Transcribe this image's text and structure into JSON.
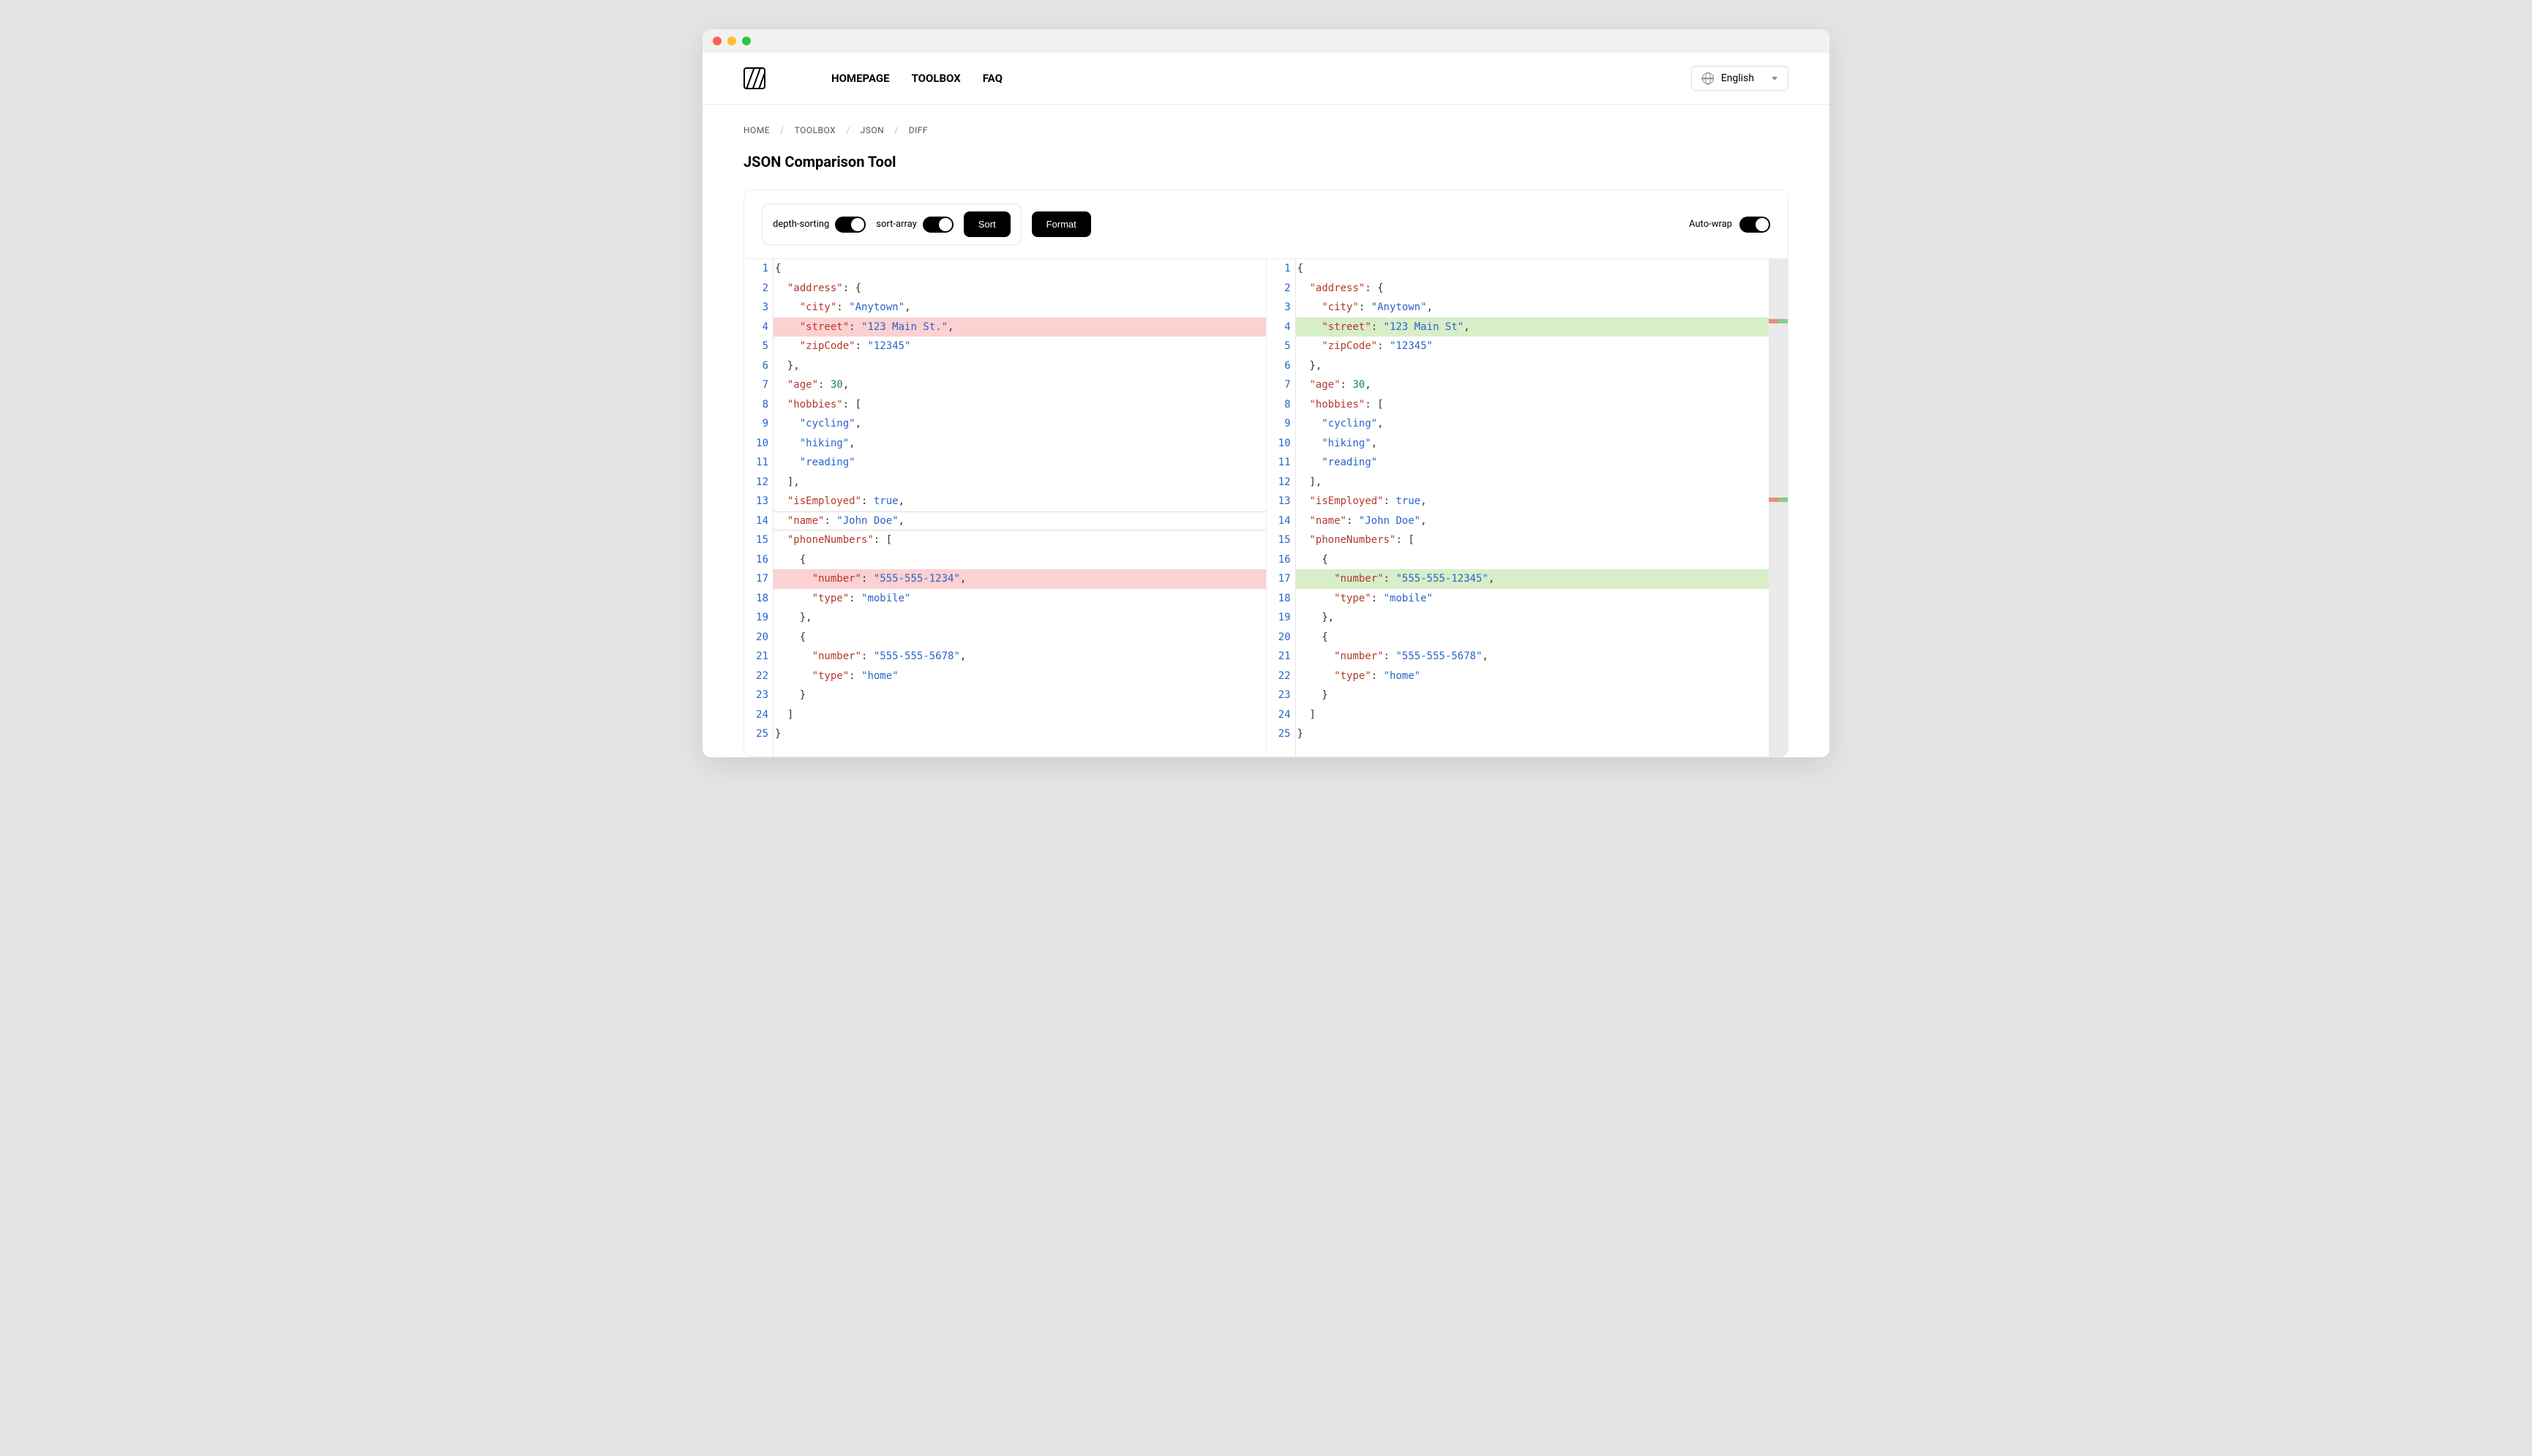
{
  "nav": {
    "items": [
      "HOMEPAGE",
      "TOOLBOX",
      "FAQ"
    ]
  },
  "lang": {
    "label": "English"
  },
  "breadcrumb": [
    "HOME",
    "TOOLBOX",
    "JSON",
    "DIFF"
  ],
  "page_title": "JSON Comparison Tool",
  "toolbar": {
    "depth_sorting": "depth-sorting",
    "sort_array": "sort-array",
    "sort_btn": "Sort",
    "format_btn": "Format",
    "auto_wrap": "Auto-wrap"
  },
  "left": {
    "lines": [
      {
        "n": 1,
        "hl": "",
        "tokens": [
          {
            "t": "punc",
            "v": "{"
          }
        ]
      },
      {
        "n": 2,
        "hl": "",
        "tokens": [
          {
            "t": "ind",
            "v": "  "
          },
          {
            "t": "key",
            "v": "\"address\""
          },
          {
            "t": "punc",
            "v": ": {"
          }
        ]
      },
      {
        "n": 3,
        "hl": "",
        "tokens": [
          {
            "t": "ind",
            "v": "    "
          },
          {
            "t": "key",
            "v": "\"city\""
          },
          {
            "t": "punc",
            "v": ": "
          },
          {
            "t": "str",
            "v": "\"Anytown\""
          },
          {
            "t": "punc",
            "v": ","
          }
        ]
      },
      {
        "n": 4,
        "hl": "red",
        "tokens": [
          {
            "t": "ind",
            "v": "    "
          },
          {
            "t": "key",
            "v": "\"street\""
          },
          {
            "t": "punc",
            "v": ": "
          },
          {
            "t": "str",
            "v": "\"123 Main St.\""
          },
          {
            "t": "punc",
            "v": ","
          }
        ]
      },
      {
        "n": 5,
        "hl": "",
        "tokens": [
          {
            "t": "ind",
            "v": "    "
          },
          {
            "t": "key",
            "v": "\"zipCode\""
          },
          {
            "t": "punc",
            "v": ": "
          },
          {
            "t": "str",
            "v": "\"12345\""
          }
        ]
      },
      {
        "n": 6,
        "hl": "",
        "tokens": [
          {
            "t": "ind",
            "v": "  "
          },
          {
            "t": "punc",
            "v": "},"
          }
        ]
      },
      {
        "n": 7,
        "hl": "",
        "tokens": [
          {
            "t": "ind",
            "v": "  "
          },
          {
            "t": "key",
            "v": "\"age\""
          },
          {
            "t": "punc",
            "v": ": "
          },
          {
            "t": "num",
            "v": "30"
          },
          {
            "t": "punc",
            "v": ","
          }
        ]
      },
      {
        "n": 8,
        "hl": "",
        "tokens": [
          {
            "t": "ind",
            "v": "  "
          },
          {
            "t": "key",
            "v": "\"hobbies\""
          },
          {
            "t": "punc",
            "v": ": ["
          }
        ]
      },
      {
        "n": 9,
        "hl": "",
        "tokens": [
          {
            "t": "ind",
            "v": "    "
          },
          {
            "t": "str",
            "v": "\"cycling\""
          },
          {
            "t": "punc",
            "v": ","
          }
        ]
      },
      {
        "n": 10,
        "hl": "",
        "tokens": [
          {
            "t": "ind",
            "v": "    "
          },
          {
            "t": "str",
            "v": "\"hiking\""
          },
          {
            "t": "punc",
            "v": ","
          }
        ]
      },
      {
        "n": 11,
        "hl": "",
        "tokens": [
          {
            "t": "ind",
            "v": "    "
          },
          {
            "t": "str",
            "v": "\"reading\""
          }
        ]
      },
      {
        "n": 12,
        "hl": "",
        "tokens": [
          {
            "t": "ind",
            "v": "  "
          },
          {
            "t": "punc",
            "v": "],"
          }
        ]
      },
      {
        "n": 13,
        "hl": "",
        "tokens": [
          {
            "t": "ind",
            "v": "  "
          },
          {
            "t": "key",
            "v": "\"isEmployed\""
          },
          {
            "t": "punc",
            "v": ": "
          },
          {
            "t": "bool",
            "v": "true"
          },
          {
            "t": "punc",
            "v": ","
          }
        ]
      },
      {
        "n": 14,
        "hl": "outline",
        "tokens": [
          {
            "t": "ind",
            "v": "  "
          },
          {
            "t": "key",
            "v": "\"name\""
          },
          {
            "t": "punc",
            "v": ": "
          },
          {
            "t": "str",
            "v": "\"John Doe\""
          },
          {
            "t": "punc",
            "v": ","
          }
        ]
      },
      {
        "n": 15,
        "hl": "",
        "tokens": [
          {
            "t": "ind",
            "v": "  "
          },
          {
            "t": "key",
            "v": "\"phoneNumbers\""
          },
          {
            "t": "punc",
            "v": ": ["
          }
        ]
      },
      {
        "n": 16,
        "hl": "",
        "tokens": [
          {
            "t": "ind",
            "v": "    "
          },
          {
            "t": "punc",
            "v": "{"
          }
        ]
      },
      {
        "n": 17,
        "hl": "red",
        "tokens": [
          {
            "t": "ind",
            "v": "      "
          },
          {
            "t": "key",
            "v": "\"number\""
          },
          {
            "t": "punc",
            "v": ": "
          },
          {
            "t": "str",
            "v": "\"555-555-1234\""
          },
          {
            "t": "punc",
            "v": ","
          }
        ]
      },
      {
        "n": 18,
        "hl": "",
        "tokens": [
          {
            "t": "ind",
            "v": "      "
          },
          {
            "t": "key",
            "v": "\"type\""
          },
          {
            "t": "punc",
            "v": ": "
          },
          {
            "t": "str",
            "v": "\"mobile\""
          }
        ]
      },
      {
        "n": 19,
        "hl": "",
        "tokens": [
          {
            "t": "ind",
            "v": "    "
          },
          {
            "t": "punc",
            "v": "},"
          }
        ]
      },
      {
        "n": 20,
        "hl": "",
        "tokens": [
          {
            "t": "ind",
            "v": "    "
          },
          {
            "t": "punc",
            "v": "{"
          }
        ]
      },
      {
        "n": 21,
        "hl": "",
        "tokens": [
          {
            "t": "ind",
            "v": "      "
          },
          {
            "t": "key",
            "v": "\"number\""
          },
          {
            "t": "punc",
            "v": ": "
          },
          {
            "t": "str",
            "v": "\"555-555-5678\""
          },
          {
            "t": "punc",
            "v": ","
          }
        ]
      },
      {
        "n": 22,
        "hl": "",
        "tokens": [
          {
            "t": "ind",
            "v": "      "
          },
          {
            "t": "key",
            "v": "\"type\""
          },
          {
            "t": "punc",
            "v": ": "
          },
          {
            "t": "str",
            "v": "\"home\""
          }
        ]
      },
      {
        "n": 23,
        "hl": "",
        "tokens": [
          {
            "t": "ind",
            "v": "    "
          },
          {
            "t": "punc",
            "v": "}"
          }
        ]
      },
      {
        "n": 24,
        "hl": "",
        "tokens": [
          {
            "t": "ind",
            "v": "  "
          },
          {
            "t": "punc",
            "v": "]"
          }
        ]
      },
      {
        "n": 25,
        "hl": "",
        "tokens": [
          {
            "t": "punc",
            "v": "}"
          }
        ]
      }
    ]
  },
  "right": {
    "lines": [
      {
        "n": 1,
        "hl": "",
        "tokens": [
          {
            "t": "punc",
            "v": "{"
          }
        ]
      },
      {
        "n": 2,
        "hl": "",
        "tokens": [
          {
            "t": "ind",
            "v": "  "
          },
          {
            "t": "key",
            "v": "\"address\""
          },
          {
            "t": "punc",
            "v": ": {"
          }
        ]
      },
      {
        "n": 3,
        "hl": "",
        "tokens": [
          {
            "t": "ind",
            "v": "    "
          },
          {
            "t": "key",
            "v": "\"city\""
          },
          {
            "t": "punc",
            "v": ": "
          },
          {
            "t": "str",
            "v": "\"Anytown\""
          },
          {
            "t": "punc",
            "v": ","
          }
        ]
      },
      {
        "n": 4,
        "hl": "green",
        "tokens": [
          {
            "t": "ind",
            "v": "    "
          },
          {
            "t": "key",
            "v": "\"street\""
          },
          {
            "t": "punc",
            "v": ": "
          },
          {
            "t": "str",
            "v": "\"123 Main St\""
          },
          {
            "t": "punc",
            "v": ","
          }
        ]
      },
      {
        "n": 5,
        "hl": "",
        "tokens": [
          {
            "t": "ind",
            "v": "    "
          },
          {
            "t": "key",
            "v": "\"zipCode\""
          },
          {
            "t": "punc",
            "v": ": "
          },
          {
            "t": "str",
            "v": "\"12345\""
          }
        ]
      },
      {
        "n": 6,
        "hl": "",
        "tokens": [
          {
            "t": "ind",
            "v": "  "
          },
          {
            "t": "punc",
            "v": "},"
          }
        ]
      },
      {
        "n": 7,
        "hl": "",
        "tokens": [
          {
            "t": "ind",
            "v": "  "
          },
          {
            "t": "key",
            "v": "\"age\""
          },
          {
            "t": "punc",
            "v": ": "
          },
          {
            "t": "num",
            "v": "30"
          },
          {
            "t": "punc",
            "v": ","
          }
        ]
      },
      {
        "n": 8,
        "hl": "",
        "tokens": [
          {
            "t": "ind",
            "v": "  "
          },
          {
            "t": "key",
            "v": "\"hobbies\""
          },
          {
            "t": "punc",
            "v": ": ["
          }
        ]
      },
      {
        "n": 9,
        "hl": "",
        "tokens": [
          {
            "t": "ind",
            "v": "    "
          },
          {
            "t": "str",
            "v": "\"cycling\""
          },
          {
            "t": "punc",
            "v": ","
          }
        ]
      },
      {
        "n": 10,
        "hl": "",
        "tokens": [
          {
            "t": "ind",
            "v": "    "
          },
          {
            "t": "str",
            "v": "\"hiking\""
          },
          {
            "t": "punc",
            "v": ","
          }
        ]
      },
      {
        "n": 11,
        "hl": "",
        "tokens": [
          {
            "t": "ind",
            "v": "    "
          },
          {
            "t": "str",
            "v": "\"reading\""
          }
        ]
      },
      {
        "n": 12,
        "hl": "",
        "tokens": [
          {
            "t": "ind",
            "v": "  "
          },
          {
            "t": "punc",
            "v": "],"
          }
        ]
      },
      {
        "n": 13,
        "hl": "",
        "tokens": [
          {
            "t": "ind",
            "v": "  "
          },
          {
            "t": "key",
            "v": "\"isEmployed\""
          },
          {
            "t": "punc",
            "v": ": "
          },
          {
            "t": "bool",
            "v": "true"
          },
          {
            "t": "punc",
            "v": ","
          }
        ]
      },
      {
        "n": 14,
        "hl": "",
        "tokens": [
          {
            "t": "ind",
            "v": "  "
          },
          {
            "t": "key",
            "v": "\"name\""
          },
          {
            "t": "punc",
            "v": ": "
          },
          {
            "t": "str",
            "v": "\"John Doe\""
          },
          {
            "t": "punc",
            "v": ","
          }
        ]
      },
      {
        "n": 15,
        "hl": "",
        "tokens": [
          {
            "t": "ind",
            "v": "  "
          },
          {
            "t": "key",
            "v": "\"phoneNumbers\""
          },
          {
            "t": "punc",
            "v": ": ["
          }
        ]
      },
      {
        "n": 16,
        "hl": "",
        "tokens": [
          {
            "t": "ind",
            "v": "    "
          },
          {
            "t": "punc",
            "v": "{"
          }
        ]
      },
      {
        "n": 17,
        "hl": "green",
        "tokens": [
          {
            "t": "ind",
            "v": "      "
          },
          {
            "t": "key",
            "v": "\"number\""
          },
          {
            "t": "punc",
            "v": ": "
          },
          {
            "t": "str",
            "v": "\"555-555-12345\""
          },
          {
            "t": "punc",
            "v": ","
          }
        ]
      },
      {
        "n": 18,
        "hl": "",
        "tokens": [
          {
            "t": "ind",
            "v": "      "
          },
          {
            "t": "key",
            "v": "\"type\""
          },
          {
            "t": "punc",
            "v": ": "
          },
          {
            "t": "str",
            "v": "\"mobile\""
          }
        ]
      },
      {
        "n": 19,
        "hl": "",
        "tokens": [
          {
            "t": "ind",
            "v": "    "
          },
          {
            "t": "punc",
            "v": "},"
          }
        ]
      },
      {
        "n": 20,
        "hl": "",
        "tokens": [
          {
            "t": "ind",
            "v": "    "
          },
          {
            "t": "punc",
            "v": "{"
          }
        ]
      },
      {
        "n": 21,
        "hl": "",
        "tokens": [
          {
            "t": "ind",
            "v": "      "
          },
          {
            "t": "key",
            "v": "\"number\""
          },
          {
            "t": "punc",
            "v": ": "
          },
          {
            "t": "str",
            "v": "\"555-555-5678\""
          },
          {
            "t": "punc",
            "v": ","
          }
        ]
      },
      {
        "n": 22,
        "hl": "",
        "tokens": [
          {
            "t": "ind",
            "v": "      "
          },
          {
            "t": "key",
            "v": "\"type\""
          },
          {
            "t": "punc",
            "v": ": "
          },
          {
            "t": "str",
            "v": "\"home\""
          }
        ]
      },
      {
        "n": 23,
        "hl": "",
        "tokens": [
          {
            "t": "ind",
            "v": "    "
          },
          {
            "t": "punc",
            "v": "}"
          }
        ]
      },
      {
        "n": 24,
        "hl": "",
        "tokens": [
          {
            "t": "ind",
            "v": "  "
          },
          {
            "t": "punc",
            "v": "]"
          }
        ]
      },
      {
        "n": 25,
        "hl": "",
        "tokens": [
          {
            "t": "punc",
            "v": "}"
          }
        ]
      }
    ]
  },
  "minimap_marks": [
    {
      "top_pct": 12
    },
    {
      "top_pct": 48
    }
  ]
}
